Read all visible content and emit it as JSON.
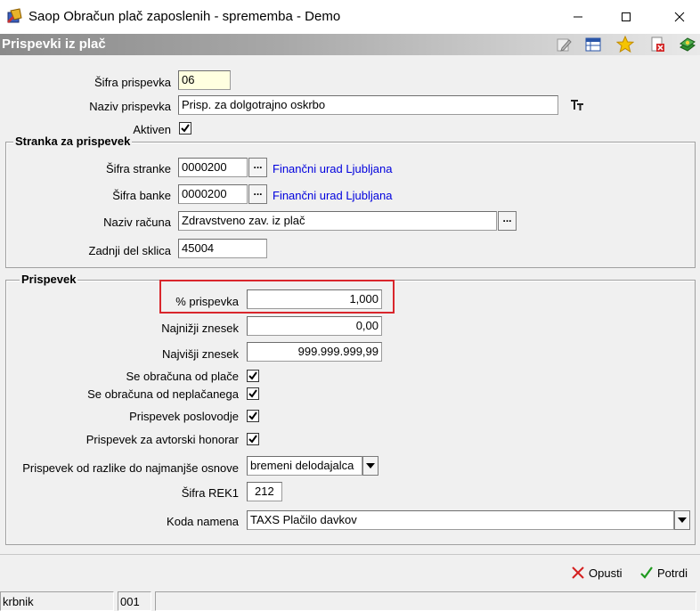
{
  "window": {
    "title": "Saop Obračun plač zaposlenih - sprememba - Demo"
  },
  "header": {
    "title": "Prispevki iz plač"
  },
  "form": {
    "sifra_prispevka": {
      "label": "Šifra prispevka",
      "value": "06"
    },
    "naziv_prispevka": {
      "label": "Naziv prispevka",
      "value": "Prisp. za dolgotrajno oskrbo"
    },
    "aktiven": {
      "label": "Aktiven",
      "checked": true
    }
  },
  "stranka": {
    "title": "Stranka za prispevek",
    "sifra_stranke": {
      "label": "Šifra stranke",
      "value": "0000200",
      "link": "Finančni urad Ljubljana"
    },
    "sifra_banke": {
      "label": "Šifra banke",
      "value": "0000200",
      "link": "Finančni urad Ljubljana"
    },
    "naziv_racuna": {
      "label": "Naziv računa",
      "value": "Zdravstveno zav. iz plač"
    },
    "zadnji_del_sklica": {
      "label": "Zadnji del sklica",
      "value": "45004"
    },
    "dots": "..."
  },
  "prispevek": {
    "title": "Prispevek",
    "procent": {
      "label": "% prispevka",
      "value": "1,000"
    },
    "najnizji": {
      "label": "Najnižji znesek",
      "value": "0,00"
    },
    "najvisji": {
      "label": "Najvišji znesek",
      "value": "999.999.999,99"
    },
    "od_place": {
      "label": "Se obračuna od plače",
      "checked": true
    },
    "od_neplacanega": {
      "label": "Se obračuna od neplačanega",
      "checked": true
    },
    "poslovodje": {
      "label": "Prispevek poslovodje",
      "checked": true
    },
    "avtorski": {
      "label": "Prispevek za avtorski honorar",
      "checked": true
    },
    "od_razlike": {
      "label": "Prispevek od razlike do najmanjše osnove",
      "value": "bremeni delodajalca"
    },
    "sifra_rek1": {
      "label": "Šifra REK1",
      "value": "212"
    },
    "koda_namena": {
      "label": "Koda namena",
      "value": "TAXS Plačilo davkov"
    }
  },
  "actions": {
    "cancel_label": "Opusti",
    "confirm_label": "Potrdi"
  },
  "status": {
    "user": "krbnik",
    "code": "001"
  },
  "colors": {
    "link": "#0000dd",
    "highlight": "#d9262c",
    "header_gradient_start": "#8a8a8a"
  }
}
